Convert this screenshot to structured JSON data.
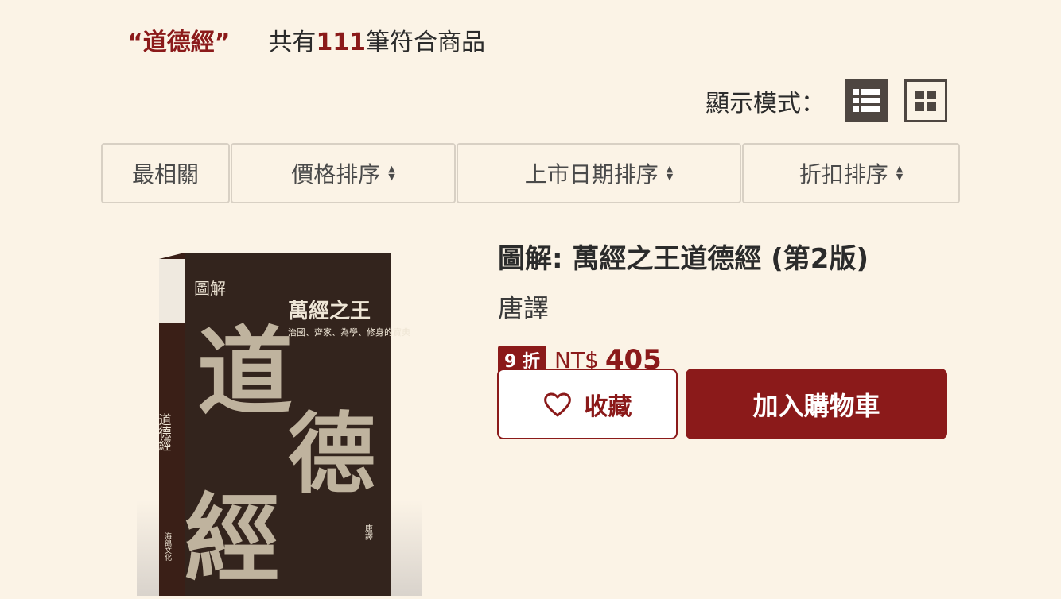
{
  "search": {
    "query": "“道德經”",
    "count_prefix": "共有",
    "count": "111",
    "count_suffix": "筆符合商品"
  },
  "view_mode": {
    "label": "顯示模式：",
    "options": [
      {
        "icon": "list-view-icon",
        "selected": true
      },
      {
        "icon": "grid-view-icon",
        "selected": false
      }
    ]
  },
  "sort": {
    "options": [
      "最相關",
      "價格排序",
      "上市日期排序",
      "折扣排序"
    ]
  },
  "product": {
    "title": "圖解: 萬經之王道德經 (第2版)",
    "author": "唐譯",
    "discount": "9 折",
    "currency": "NT$",
    "price": "405",
    "favorite_label": "收藏",
    "cart_label": "加入購物車",
    "cover": {
      "title_big": "道德經",
      "subtitle": "萬經之王",
      "tagline": "治國、齊家、為學、修身的寶典",
      "badge": "圖解",
      "spine_title": "道德經",
      "publisher": "海鴿文化",
      "author": "唐譯"
    }
  },
  "colors": {
    "background": "#fbf3e6",
    "accent": "#8b1a1a",
    "icon_dark": "#4e4641"
  }
}
